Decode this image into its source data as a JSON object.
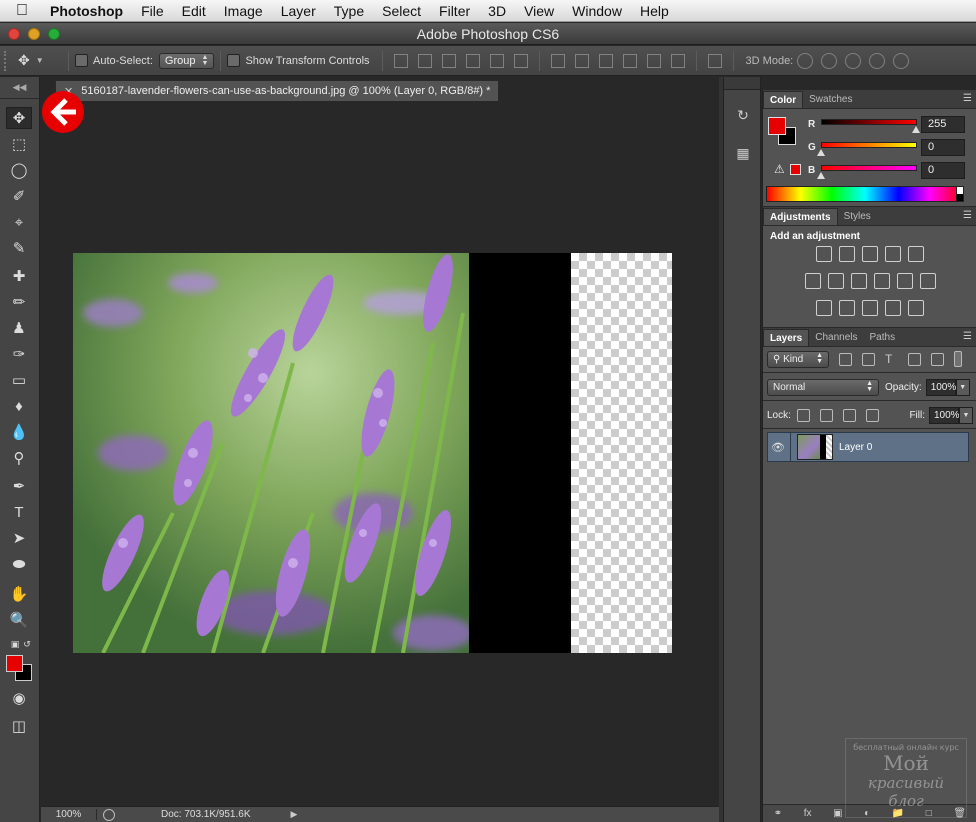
{
  "menubar": {
    "app": "Photoshop",
    "items": [
      "File",
      "Edit",
      "Image",
      "Layer",
      "Type",
      "Select",
      "Filter",
      "3D",
      "View",
      "Window",
      "Help"
    ]
  },
  "window": {
    "title": "Adobe Photoshop CS6"
  },
  "options": {
    "auto_select_label": "Auto-Select:",
    "auto_select_value": "Group",
    "show_transform_label": "Show Transform Controls",
    "mode3d_label": "3D Mode:"
  },
  "document": {
    "tab_title": "5160187-lavender-flowers-can-use-as-background.jpg @ 100% (Layer 0, RGB/8#) *",
    "zoom": "100%",
    "doc_size": "Doc: 703.1K/951.6K"
  },
  "color_panel": {
    "tabs": [
      "Color",
      "Swatches"
    ],
    "r_label": "R",
    "r_value": "255",
    "g_label": "G",
    "g_value": "0",
    "b_label": "B",
    "b_value": "0",
    "fg": "#e60000",
    "bg": "#000000"
  },
  "adjustments_panel": {
    "tabs": [
      "Adjustments",
      "Styles"
    ],
    "title": "Add an adjustment"
  },
  "layers_panel": {
    "tabs": [
      "Layers",
      "Channels",
      "Paths"
    ],
    "kind_label": "Kind",
    "blend_mode": "Normal",
    "opacity_label": "Opacity:",
    "opacity_value": "100%",
    "lock_label": "Lock:",
    "fill_label": "Fill:",
    "fill_value": "100%",
    "layers": [
      {
        "name": "Layer 0"
      }
    ]
  },
  "watermark": {
    "small": "бесплатный онлайн курс",
    "line1": "Мой",
    "line2": "красивый",
    "line3": "блог"
  }
}
